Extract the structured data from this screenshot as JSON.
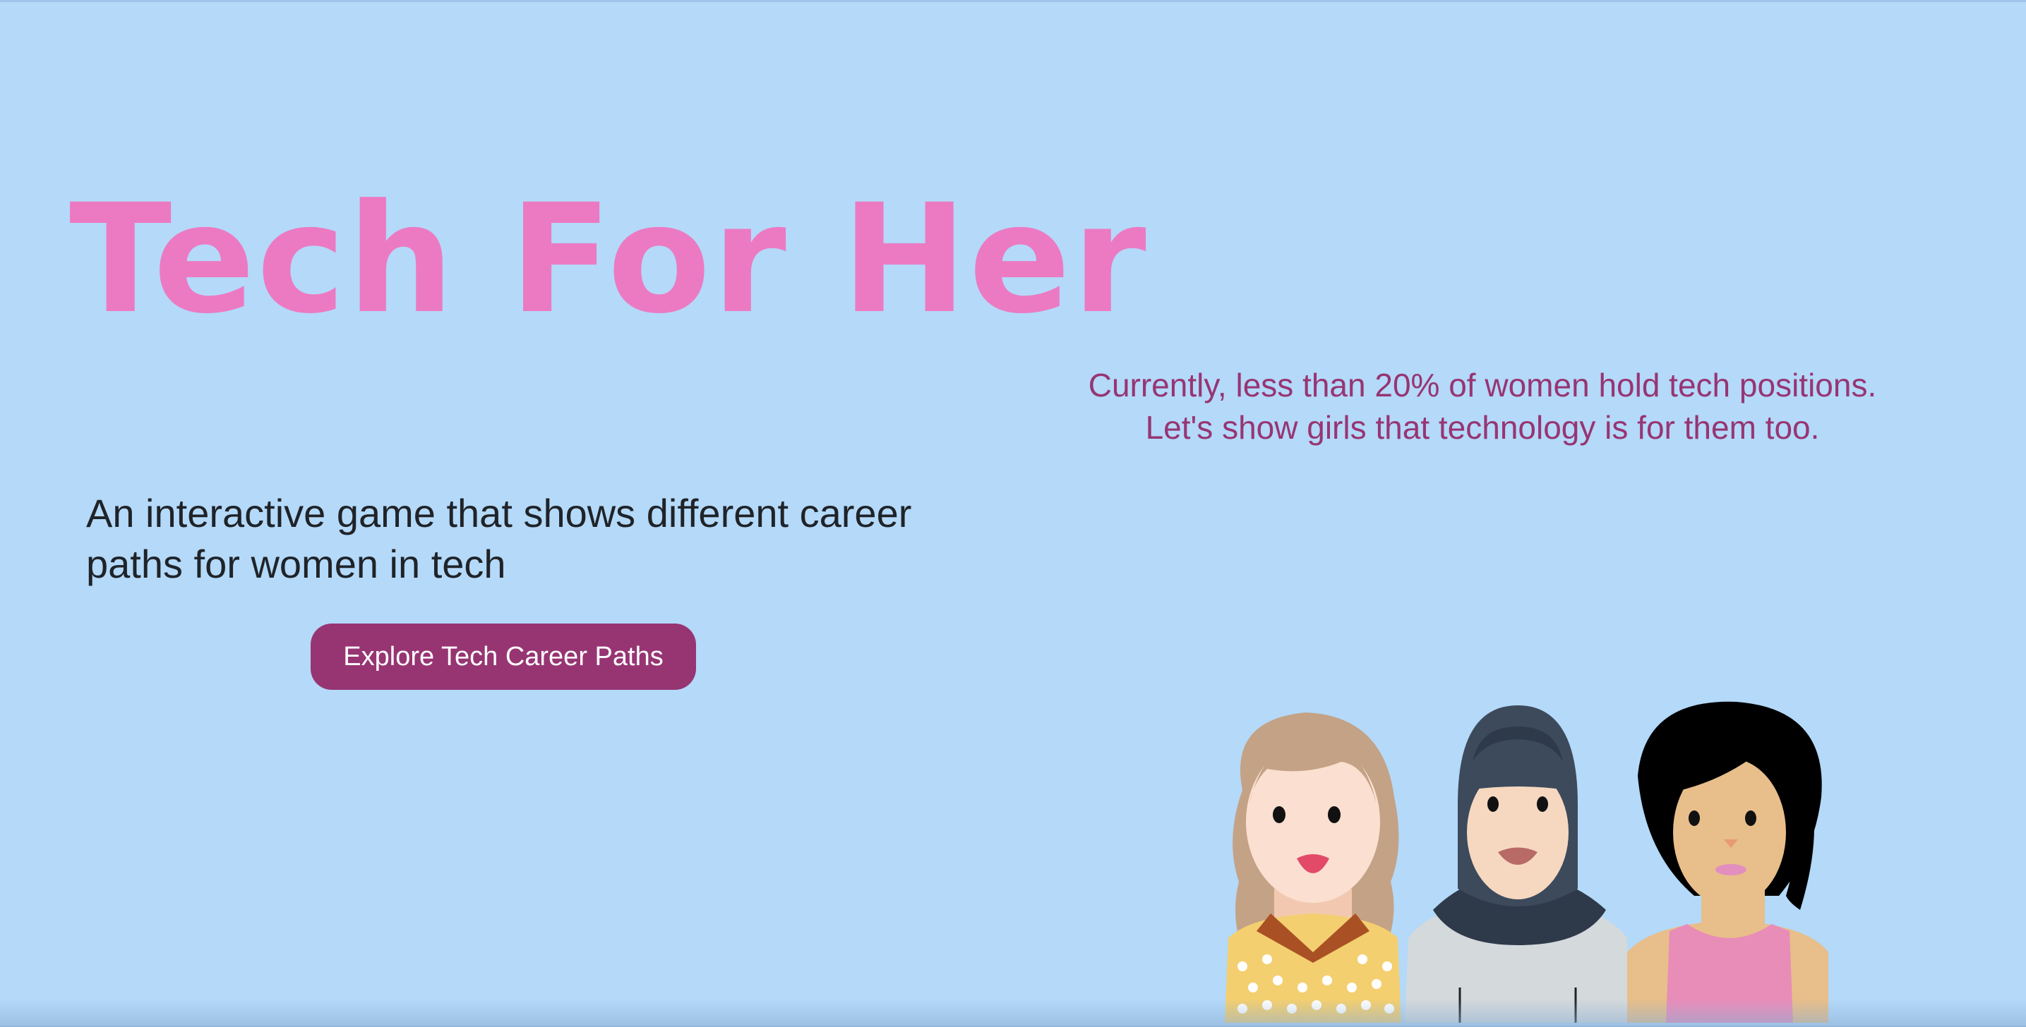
{
  "hero": {
    "title": "Tech For Her",
    "tagline": "An interactive game that shows different career paths for women in tech",
    "cta_label": "Explore Tech Career Paths"
  },
  "stats": {
    "line1": "Currently, less than 20% of women hold tech positions.",
    "line2": "Let's show girls that technology is for them too."
  },
  "colors": {
    "background": "#b4d9f9",
    "title_pink": "#ec7ac2",
    "accent_plum": "#973573",
    "text_dark": "#1f2328"
  },
  "illustration": {
    "icon": "three-women-avatars-icon"
  }
}
